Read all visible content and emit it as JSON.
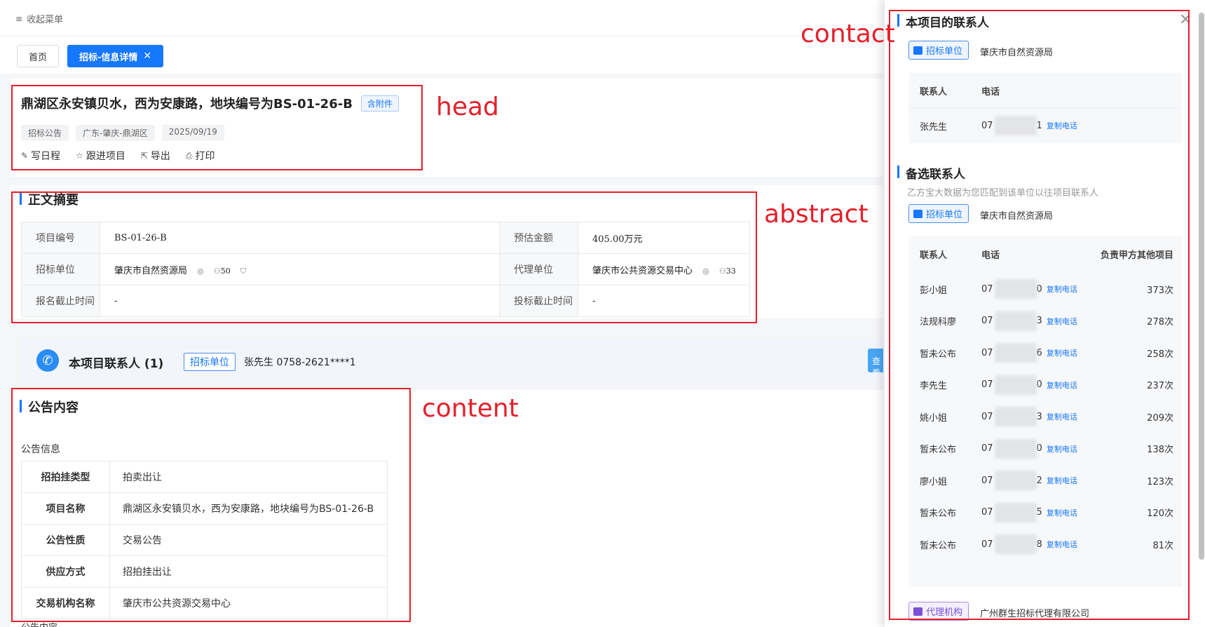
{
  "topbar": {
    "collapse_label": "收起菜单",
    "collapse_icon": "menu-fold-icon"
  },
  "tabs": [
    {
      "label": "首页"
    },
    {
      "label": "招标-信息详情",
      "close": "✕"
    }
  ],
  "head": {
    "title": "鼎湖区永安镇贝水，西为安康路，地块编号为BS-01-26-B",
    "badge": "含附件",
    "tags": [
      "招标公告",
      "广东-肇庆-鼎湖区",
      "2025/09/19"
    ],
    "actions": [
      {
        "label": "写日程",
        "icon": "edit-icon"
      },
      {
        "label": "跟进项目",
        "icon": "star-icon"
      },
      {
        "label": "导出",
        "icon": "export-icon"
      },
      {
        "label": "打印",
        "icon": "print-icon"
      }
    ]
  },
  "abstract": {
    "title": "正文摘要",
    "rows": [
      {
        "k1": "项目编号",
        "v1": "BS-01-26-B",
        "k2": "预估金额",
        "v2": "405.00万元"
      },
      {
        "k1": "招标单位",
        "v1": "肇庆市自然资源局",
        "v1_count": "50",
        "k2": "代理单位",
        "v2": "肇庆市公共资源交易中心",
        "v2_count": "33"
      },
      {
        "k1": "报名截止时间",
        "v1": "-",
        "k2": "投标截止时间",
        "v2": "-"
      }
    ]
  },
  "contact_bar": {
    "title": "本项目联系人 (1)",
    "tag": "招标单位",
    "contact": "张先生  0758-2621****1",
    "button": "查看"
  },
  "content": {
    "title": "公告内容",
    "subtitle": "公告信息",
    "rows": [
      {
        "k": "招拍挂类型",
        "v": "拍卖出让"
      },
      {
        "k": "项目名称",
        "v": "鼎湖区永安镇贝水，西为安康路，地块编号为BS-01-26-B"
      },
      {
        "k": "公告性质",
        "v": "交易公告"
      },
      {
        "k": "供应方式",
        "v": "招拍挂出让"
      },
      {
        "k": "交易机构名称",
        "v": "肇庆市公共资源交易中心"
      }
    ],
    "more": "公告内容"
  },
  "drawer": {
    "section1_title": "本项目的联系人",
    "unit_tag": "招标单位",
    "unit_name": "肇庆市自然资源局",
    "col_name": "联系人",
    "col_phone": "电话",
    "col_count": "负责甲方其他项目",
    "copy_label": "复制电话",
    "primary_contacts": [
      {
        "name": "张先生",
        "phone_pre": "07",
        "phone_suf": "1"
      }
    ],
    "section2_title": "备选联系人",
    "section2_sub": "乙方宝大数据为您匹配到该单位以往项目联系人",
    "backup_contacts": [
      {
        "name": "彭小姐",
        "phone_pre": "07",
        "phone_suf": "0",
        "count": "373次"
      },
      {
        "name": "法规科廖",
        "phone_pre": "07",
        "phone_suf": "3",
        "count": "278次"
      },
      {
        "name": "暂未公布",
        "phone_pre": "07",
        "phone_suf": "6",
        "count": "258次"
      },
      {
        "name": "李先生",
        "phone_pre": "07",
        "phone_suf": "0",
        "count": "237次"
      },
      {
        "name": "姚小姐",
        "phone_pre": "07",
        "phone_suf": "3",
        "count": "209次"
      },
      {
        "name": "暂未公布",
        "phone_pre": "07",
        "phone_suf": "0",
        "count": "138次"
      },
      {
        "name": "廖小姐",
        "phone_pre": "07",
        "phone_suf": "2",
        "count": "123次"
      },
      {
        "name": "暂未公布",
        "phone_pre": "07",
        "phone_suf": "5",
        "count": "120次"
      },
      {
        "name": "暂未公布",
        "phone_pre": "07",
        "phone_suf": "8",
        "count": "81次"
      }
    ],
    "agency_tag": "代理机构",
    "agency_name": "广州群生招标代理有限公司"
  },
  "annotations": {
    "head": "head",
    "abstract": "abstract",
    "content": "content",
    "contact": "contact"
  },
  "colors": {
    "accent": "#1677ff",
    "annotation": "#e4202b",
    "agency": "#7a4fd6"
  }
}
